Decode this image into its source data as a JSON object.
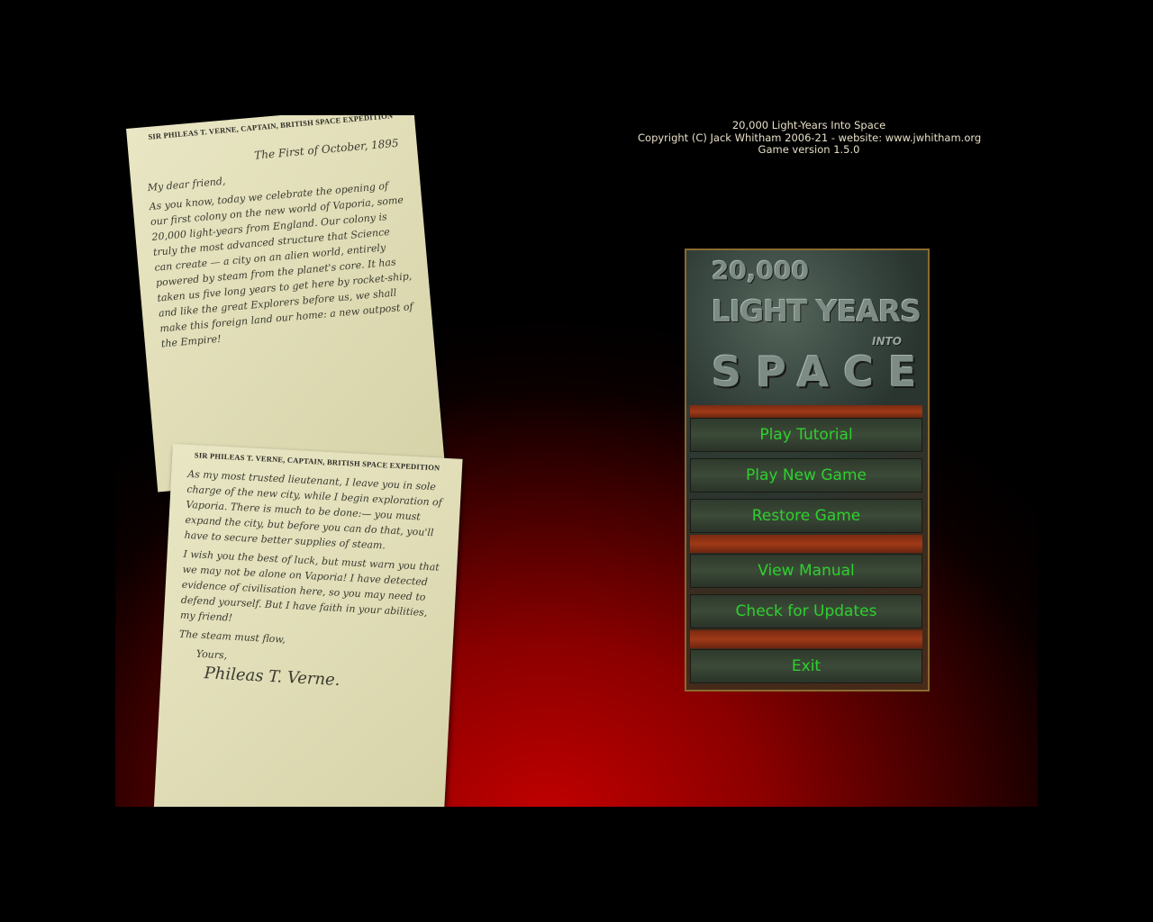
{
  "credits": {
    "title": "20,000 Light-Years Into Space",
    "copyright": "Copyright (C) Jack Whitham 2006-21 - website: www.jwhitham.org",
    "version": "Game version 1.5.0"
  },
  "letter1": {
    "letterhead": "SIR PHILEAS T. VERNE, CAPTAIN, BRITISH SPACE EXPEDITION",
    "date": "The First of October, 1895",
    "greeting": "My dear friend,",
    "body": "As you know, today we celebrate the opening of our first colony on the new world of Vaporia, some 20,000 light-years from England. Our colony is truly the most advanced structure that Science can create — a city on an alien world, entirely powered by steam from the planet's core. It has taken us five long years to get here by rocket-ship, and like the great Explorers before us, we shall make this foreign land our home: a new outpost of the Empire!"
  },
  "letter2": {
    "letterhead": "SIR PHILEAS T. VERNE, CAPTAIN, BRITISH SPACE EXPEDITION",
    "para1": "As my most trusted lieutenant, I leave you in sole charge of the new city, while I begin exploration of Vaporia. There is much to be done:— you must expand the city, but before you can do that, you'll have to secure better supplies of steam.",
    "para2": "I wish you the best of luck, but must warn you that we may not be alone on Vaporia! I have detected evidence of civilisation here, so you may need to defend yourself. But I have faith in your abilities, my friend!",
    "para3": "The steam must flow,",
    "closing": "Yours,",
    "signature": "Phileas T. Verne."
  },
  "logo": {
    "line1": "20,000",
    "line2": "LIGHT YEARS",
    "line3": "INTO",
    "line4": "SPACE"
  },
  "menu": {
    "play_tutorial": "Play Tutorial",
    "play_new_game": "Play New Game",
    "restore_game": "Restore Game",
    "view_manual": "View Manual",
    "check_updates": "Check for Updates",
    "exit": "Exit"
  },
  "colors": {
    "menu_text": "#2ed02e",
    "background_red": "#c10000",
    "paper": "#e9e6c4"
  }
}
